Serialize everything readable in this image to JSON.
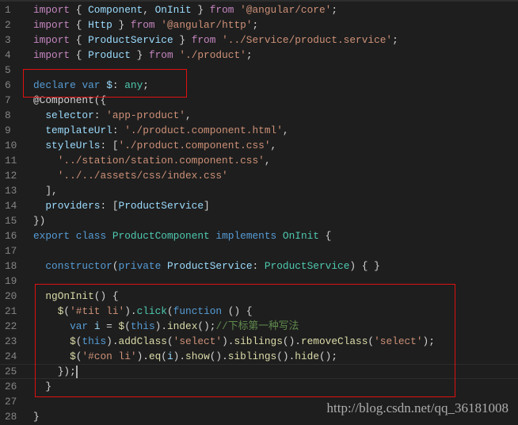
{
  "colors": {
    "background": "#1e1e1e",
    "keyword": "#c586c0",
    "storage": "#569cd6",
    "variable": "#9cdcfe",
    "string": "#ce9178",
    "type": "#4ec9b0",
    "function": "#dcdcaa",
    "comment": "#608b4e",
    "highlight_box": "#e01010"
  },
  "lines": [
    [
      [
        "k",
        "import"
      ],
      [
        "p",
        " { "
      ],
      [
        "v",
        "Component"
      ],
      [
        "p",
        ", "
      ],
      [
        "v",
        "OnInit"
      ],
      [
        "p",
        " } "
      ],
      [
        "k",
        "from"
      ],
      [
        "p",
        " "
      ],
      [
        "s",
        "'@angular/core'"
      ],
      [
        "p",
        ";"
      ]
    ],
    [
      [
        "k",
        "import"
      ],
      [
        "p",
        " { "
      ],
      [
        "v",
        "Http"
      ],
      [
        "p",
        " } "
      ],
      [
        "k",
        "from"
      ],
      [
        "p",
        " "
      ],
      [
        "s",
        "'@angular/http'"
      ],
      [
        "p",
        ";"
      ]
    ],
    [
      [
        "k",
        "import"
      ],
      [
        "p",
        " { "
      ],
      [
        "v",
        "ProductService"
      ],
      [
        "p",
        " } "
      ],
      [
        "k",
        "from"
      ],
      [
        "p",
        " "
      ],
      [
        "s",
        "'../Service/product.service'"
      ],
      [
        "p",
        ";"
      ]
    ],
    [
      [
        "k",
        "import"
      ],
      [
        "p",
        " { "
      ],
      [
        "v",
        "Product"
      ],
      [
        "p",
        " } "
      ],
      [
        "k",
        "from"
      ],
      [
        "p",
        " "
      ],
      [
        "s",
        "'./product'"
      ],
      [
        "p",
        ";"
      ]
    ],
    [],
    [
      [
        "b",
        "declare"
      ],
      [
        "p",
        " "
      ],
      [
        "b",
        "var"
      ],
      [
        "p",
        " "
      ],
      [
        "v",
        "$"
      ],
      [
        "p",
        ": "
      ],
      [
        "t",
        "any"
      ],
      [
        "p",
        ";"
      ]
    ],
    [
      [
        "p",
        "@Component({"
      ]
    ],
    [
      [
        "p",
        "  "
      ],
      [
        "v",
        "selector"
      ],
      [
        "p",
        ": "
      ],
      [
        "s",
        "'app-product'"
      ],
      [
        "p",
        ","
      ]
    ],
    [
      [
        "p",
        "  "
      ],
      [
        "v",
        "templateUrl"
      ],
      [
        "p",
        ": "
      ],
      [
        "s",
        "'./product.component.html'"
      ],
      [
        "p",
        ","
      ]
    ],
    [
      [
        "p",
        "  "
      ],
      [
        "v",
        "styleUrls"
      ],
      [
        "p",
        ": ["
      ],
      [
        "s",
        "'./product.component.css'"
      ],
      [
        "p",
        ","
      ]
    ],
    [
      [
        "p",
        "    "
      ],
      [
        "s",
        "'../station/station.component.css'"
      ],
      [
        "p",
        ","
      ]
    ],
    [
      [
        "p",
        "    "
      ],
      [
        "s",
        "'../../assets/css/index.css'"
      ]
    ],
    [
      [
        "p",
        "  ],"
      ]
    ],
    [
      [
        "p",
        "  "
      ],
      [
        "v",
        "providers"
      ],
      [
        "p",
        ": ["
      ],
      [
        "v",
        "ProductService"
      ],
      [
        "p",
        "]"
      ]
    ],
    [
      [
        "p",
        "})"
      ]
    ],
    [
      [
        "b",
        "export"
      ],
      [
        "p",
        " "
      ],
      [
        "b",
        "class"
      ],
      [
        "p",
        " "
      ],
      [
        "t",
        "ProductComponent"
      ],
      [
        "p",
        " "
      ],
      [
        "b",
        "implements"
      ],
      [
        "p",
        " "
      ],
      [
        "t",
        "OnInit"
      ],
      [
        "p",
        " {"
      ]
    ],
    [],
    [
      [
        "p",
        "  "
      ],
      [
        "b",
        "constructor"
      ],
      [
        "p",
        "("
      ],
      [
        "b",
        "private"
      ],
      [
        "p",
        " "
      ],
      [
        "v",
        "ProductService"
      ],
      [
        "p",
        ": "
      ],
      [
        "t",
        "ProductService"
      ],
      [
        "p",
        ") { }"
      ]
    ],
    [],
    [
      [
        "p",
        "  "
      ],
      [
        "f",
        "ngOnInit"
      ],
      [
        "p",
        "() {"
      ]
    ],
    [
      [
        "p",
        "    "
      ],
      [
        "f",
        "$"
      ],
      [
        "p",
        "("
      ],
      [
        "s",
        "'#tit li'"
      ],
      [
        "p",
        ")."
      ],
      [
        "t",
        "click"
      ],
      [
        "p",
        "("
      ],
      [
        "b",
        "function"
      ],
      [
        "p",
        " () {"
      ]
    ],
    [
      [
        "p",
        "      "
      ],
      [
        "b",
        "var"
      ],
      [
        "p",
        " "
      ],
      [
        "v",
        "i"
      ],
      [
        "p",
        " = "
      ],
      [
        "f",
        "$"
      ],
      [
        "p",
        "("
      ],
      [
        "b",
        "this"
      ],
      [
        "p",
        ")."
      ],
      [
        "f",
        "index"
      ],
      [
        "p",
        "();"
      ],
      [
        "c",
        "//下标第一种写法"
      ]
    ],
    [
      [
        "p",
        "      "
      ],
      [
        "f",
        "$"
      ],
      [
        "p",
        "("
      ],
      [
        "b",
        "this"
      ],
      [
        "p",
        ")."
      ],
      [
        "f",
        "addClass"
      ],
      [
        "p",
        "("
      ],
      [
        "s",
        "'select'"
      ],
      [
        "p",
        ")."
      ],
      [
        "f",
        "siblings"
      ],
      [
        "p",
        "()."
      ],
      [
        "f",
        "removeClass"
      ],
      [
        "p",
        "("
      ],
      [
        "s",
        "'select'"
      ],
      [
        "p",
        ");"
      ]
    ],
    [
      [
        "p",
        "      "
      ],
      [
        "f",
        "$"
      ],
      [
        "p",
        "("
      ],
      [
        "s",
        "'#con li'"
      ],
      [
        "p",
        ")."
      ],
      [
        "f",
        "eq"
      ],
      [
        "p",
        "("
      ],
      [
        "v",
        "i"
      ],
      [
        "p",
        ")."
      ],
      [
        "f",
        "show"
      ],
      [
        "p",
        "()."
      ],
      [
        "f",
        "siblings"
      ],
      [
        "p",
        "()."
      ],
      [
        "f",
        "hide"
      ],
      [
        "p",
        "();"
      ]
    ],
    [
      [
        "p",
        "    });"
      ]
    ],
    [
      [
        "p",
        "  }"
      ]
    ],
    [],
    [
      [
        "p",
        "}"
      ]
    ]
  ],
  "line_numbers": [
    "1",
    "2",
    "3",
    "4",
    "5",
    "6",
    "7",
    "8",
    "9",
    "10",
    "11",
    "12",
    "13",
    "14",
    "15",
    "16",
    "17",
    "18",
    "19",
    "20",
    "21",
    "22",
    "23",
    "24",
    "25",
    "26",
    "27",
    "28"
  ],
  "current_line": 25,
  "watermark": "http://blog.csdn.net/qq_36181008"
}
